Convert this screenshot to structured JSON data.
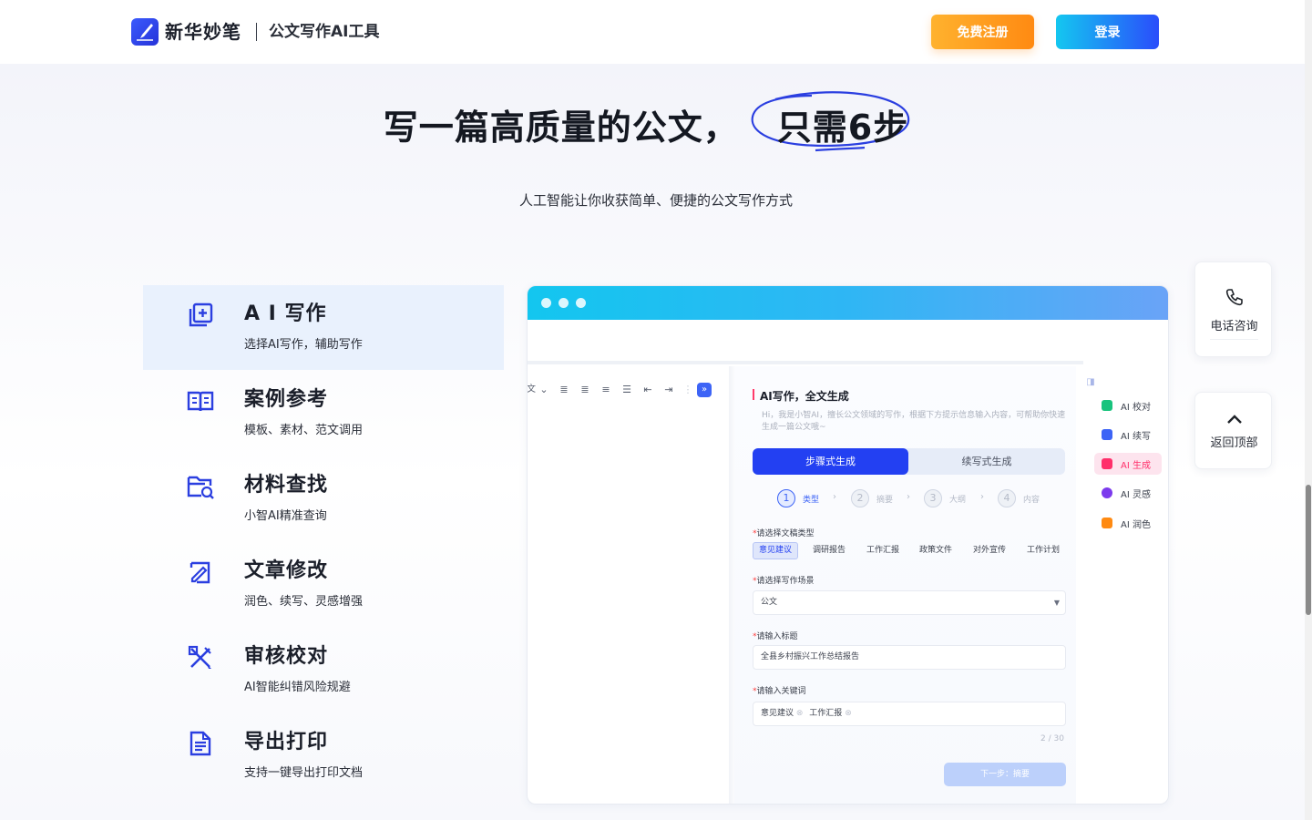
{
  "header": {
    "brand_name": "新华妙笔",
    "brand_sub": "公文写作AI工具",
    "register_label": "免费注册",
    "login_label": "登录"
  },
  "hero": {
    "title_main": "写一篇高质量的公文，",
    "title_highlight": "只需6步",
    "subtitle": "人工智能让你收获简单、便捷的公文写作方式"
  },
  "features": [
    {
      "title": "A I 写作",
      "desc": "选择AI写作，辅助写作",
      "icon": "ai-write-icon",
      "active": true
    },
    {
      "title": "案例参考",
      "desc": "模板、素材、范文调用",
      "icon": "book-icon",
      "active": false
    },
    {
      "title": "材料查找",
      "desc": "小智AI精准查询",
      "icon": "folder-search-icon",
      "active": false
    },
    {
      "title": "文章修改",
      "desc": "润色、续写、灵感增强",
      "icon": "edit-icon",
      "active": false
    },
    {
      "title": "审核校对",
      "desc": "AI智能纠错风险规避",
      "icon": "proofread-icon",
      "active": false
    },
    {
      "title": "导出打印",
      "desc": "支持一键导出打印文档",
      "icon": "document-icon",
      "active": false
    }
  ],
  "app": {
    "panel_title": "AI写作，全文生成",
    "panel_intro": "Hi，我是小智AI，擅长公文领域的写作，根据下方提示信息输入内容，可帮助你快速生成一篇公文哦~",
    "mode_tabs": [
      "步骤式生成",
      "续写式生成"
    ],
    "steps": [
      {
        "num": "1",
        "label": "类型"
      },
      {
        "num": "2",
        "label": "摘要"
      },
      {
        "num": "3",
        "label": "大纲"
      },
      {
        "num": "4",
        "label": "内容"
      }
    ],
    "doc_type_label": "请选择文稿类型",
    "doc_types": [
      "意见建议",
      "调研报告",
      "工作汇报",
      "政策文件",
      "对外宣传",
      "工作计划"
    ],
    "scene_label": "请选择写作场景",
    "scene_value": "公文",
    "title_label": "请输入标题",
    "title_value": "全县乡村振兴工作总结报告",
    "keywords_label": "请输入关键词",
    "keywords": [
      "意见建议",
      "工作汇报"
    ],
    "keywords_count": "2 / 30",
    "next_label": "下一步：摘要",
    "toolbar_text": "文",
    "ai_tools": [
      {
        "label": "AI 校对",
        "color": "#19c37d",
        "active": false
      },
      {
        "label": "AI 续写",
        "color": "#3d64f6",
        "active": false
      },
      {
        "label": "AI 生成",
        "color": "#ff2f6a",
        "active": true
      },
      {
        "label": "AI 灵感",
        "color": "#7c3aed",
        "active": false
      },
      {
        "label": "AI 润色",
        "color": "#ff8a12",
        "active": false
      }
    ]
  },
  "float": {
    "phone_label": "电话咨询",
    "top_label": "返回顶部"
  }
}
